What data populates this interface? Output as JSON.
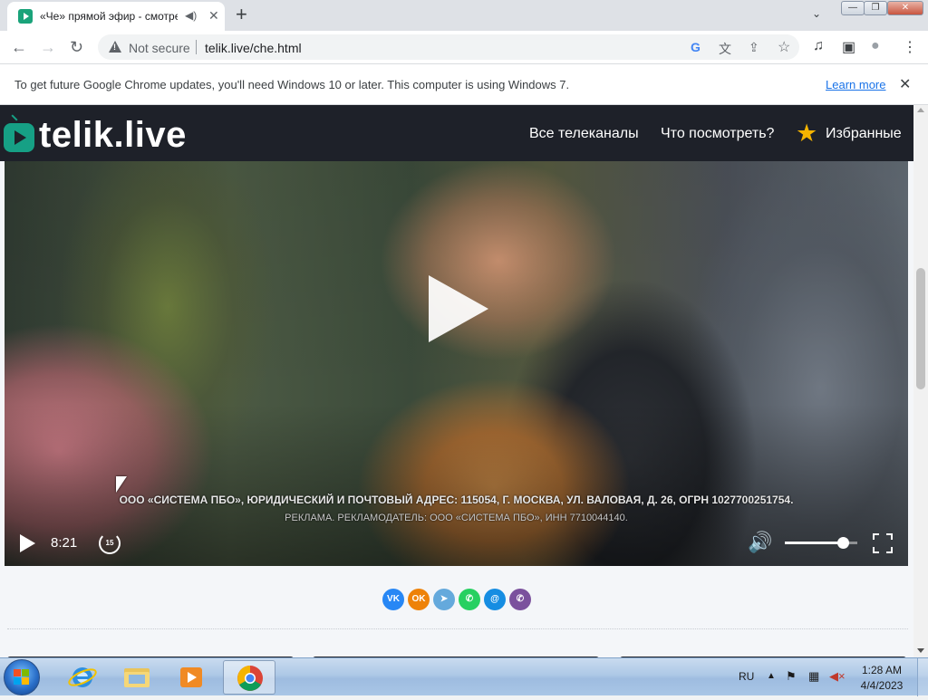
{
  "browser": {
    "tab": {
      "title": "«Че» прямой эфир - смотреть онлайн",
      "audio_icon": "speaker-icon",
      "close_label": "✕"
    },
    "newtab_label": "+",
    "tab_search_label": "⌄",
    "window_controls": {
      "minimize": "—",
      "restore": "❐",
      "close": "✕"
    },
    "nav": {
      "back": "←",
      "forward": "→",
      "reload": "↻"
    },
    "omnibox": {
      "security_label": "Not secure",
      "url": "telik.live/che.html"
    },
    "omnibox_icons": {
      "google": "G",
      "translate": "文",
      "share": "⇪",
      "bookmark": "☆"
    },
    "toolbar_icons": {
      "media": "♫",
      "sidepanel": "▣",
      "profile": "●",
      "menu": "⋮"
    },
    "infobar": {
      "message": "To get future Google Chrome updates, you'll need Windows 10 or later. This computer is using Windows 7.",
      "link": "Learn more",
      "close": "✕"
    }
  },
  "site": {
    "logo": "telik.live",
    "nav": {
      "all_channels": "Все телеканалы",
      "what_to_watch": "Что посмотреть?",
      "favorites": "Избранные"
    },
    "star_icon": "★"
  },
  "player": {
    "subtitle_line1": "ООО «СИСТЕМА ПБО», ЮРИДИЧЕСКИЙ И ПОЧТОВЫЙ АДРЕС: 115054, Г. МОСКВА, УЛ. ВАЛОВАЯ, Д. 26, ОГРН 1027700251754.",
    "subtitle_line2": "РЕКЛАМА. РЕКЛАМОДАТЕЛЬ: ООО «СИСТЕМА ПБО», ИНН 7710044140.",
    "time": "8:21",
    "rewind_seconds": "15",
    "volume_level": 0.8,
    "volume_icon": "🔊"
  },
  "share": [
    {
      "name": "vk",
      "label": "VK",
      "color": "#2787f5"
    },
    {
      "name": "odnoklassniki",
      "label": "OK",
      "color": "#ee8208"
    },
    {
      "name": "telegram",
      "label": "➤",
      "color": "#64a9dc"
    },
    {
      "name": "whatsapp",
      "label": "✆",
      "color": "#27d061"
    },
    {
      "name": "moimir",
      "label": "@",
      "color": "#168de2"
    },
    {
      "name": "viber",
      "label": "✆",
      "color": "#7b519d"
    }
  ],
  "taskbar": {
    "language": "RU",
    "tray_up": "▲",
    "clock_time": "1:28 AM",
    "clock_date": "4/4/2023"
  }
}
